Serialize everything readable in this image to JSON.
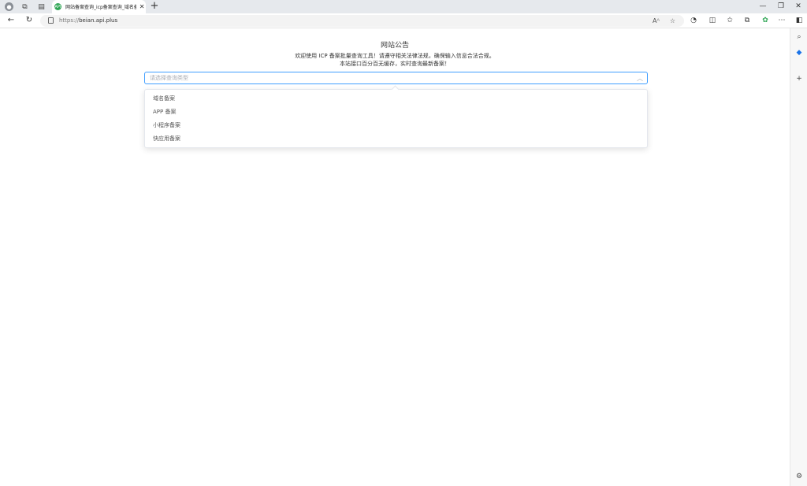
{
  "browser": {
    "tab": {
      "title": "网站备案查询_icp备案查询_域名备案",
      "favicon": "API"
    },
    "url": {
      "scheme": "https://",
      "host": "beian.api.plus"
    },
    "read_aloud": "Aᴬ"
  },
  "page": {
    "notice_title": "网站公告",
    "notice_line1": "欢迎使用 ICP 备案批量查询工具！请遵守相关法律法规，确保输入信息合法合规。",
    "notice_line2": "本站接口百分百无缓存，实时查询最新备案！",
    "select": {
      "placeholder": "请选择查询类型",
      "options": [
        "域名备案",
        "APP 备案",
        "小程序备案",
        "快应用备案"
      ]
    }
  },
  "colors": {
    "accent": "#409eff",
    "favicon_green": "#2fa655",
    "edge_blue": "#1a73e8"
  }
}
